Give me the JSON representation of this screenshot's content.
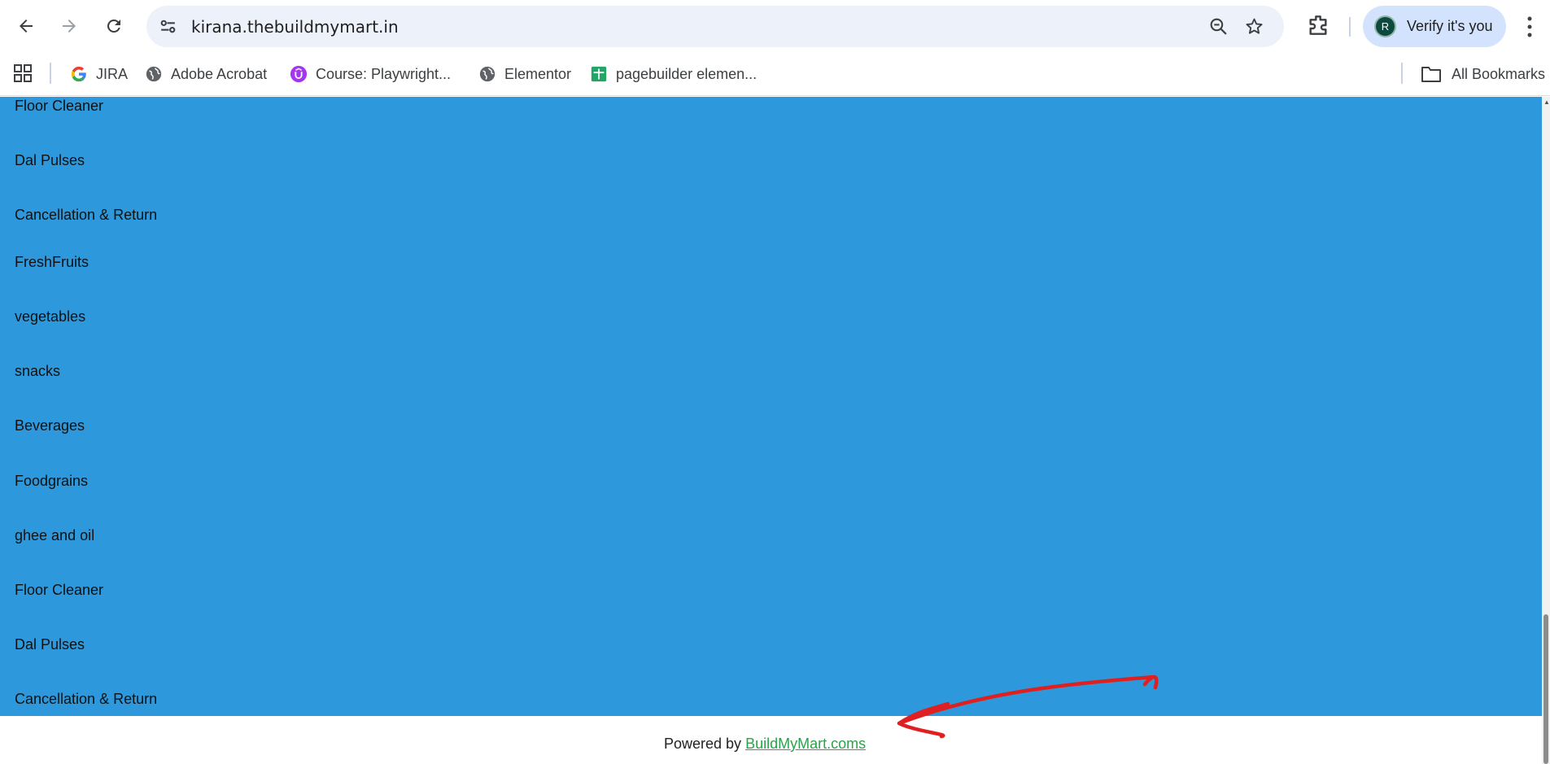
{
  "browser": {
    "url": "kirana.thebuildmymart.in",
    "profile_label": "Verify it's you",
    "profile_initial": "R",
    "bookmarks": [
      {
        "label": "JIRA",
        "icon": "google-icon"
      },
      {
        "label": "Adobe Acrobat",
        "icon": "globe-icon"
      },
      {
        "label": "Course: Playwright...",
        "icon": "udemy-icon"
      },
      {
        "label": "Elementor",
        "icon": "globe-icon"
      },
      {
        "label": "pagebuilder elemen...",
        "icon": "sheets-icon"
      }
    ],
    "all_bookmarks_label": "All Bookmarks"
  },
  "page": {
    "categories": [
      "Floor Cleaner",
      "Dal Pulses",
      "Cancellation & Return",
      "FreshFruits",
      "vegetables",
      "snacks",
      "Beverages",
      "Foodgrains",
      "ghee and oil",
      "Floor Cleaner",
      "Dal Pulses",
      "Cancellation & Return"
    ],
    "footer": {
      "powered_prefix": "Powered by ",
      "powered_link": "BuildMyMart.coms"
    },
    "colors": {
      "section_bg": "#2d98db",
      "link_color": "#2aa34a",
      "annotation_arrow": "#e02020"
    }
  }
}
